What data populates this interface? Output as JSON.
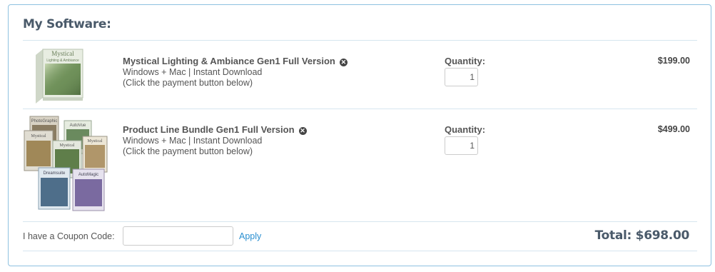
{
  "title": "My Software:",
  "items": [
    {
      "name": "Mystical Lighting & Ambiance Gen1 Full Version",
      "platform": "Windows + Mac | Instant Download",
      "note": "(Click the payment button below)",
      "quantity_label": "Quantity:",
      "quantity": "1",
      "price": "$199.00",
      "box_text": "Mystical",
      "box_subtext": "Lighting & Ambiance"
    },
    {
      "name": "Product Line Bundle Gen1 Full Version",
      "platform": "Windows + Mac | Instant Download",
      "note": "(Click the payment button below)",
      "quantity_label": "Quantity:",
      "quantity": "1",
      "price": "$499.00",
      "box_labels": [
        "PhotoGraphic",
        "AutoVue",
        "Mystical",
        "Mystical",
        "Mystical",
        "Dreamsuite",
        "AutoMagic"
      ]
    }
  ],
  "coupon": {
    "label": "I have a Coupon Code:",
    "value": "",
    "apply_label": "Apply"
  },
  "total": "Total: $698.00",
  "remove_icon": "close-circle-icon",
  "colors": {
    "accent": "#2a8fd0",
    "border": "#8ec1e0",
    "title": "#4a5a6a"
  }
}
